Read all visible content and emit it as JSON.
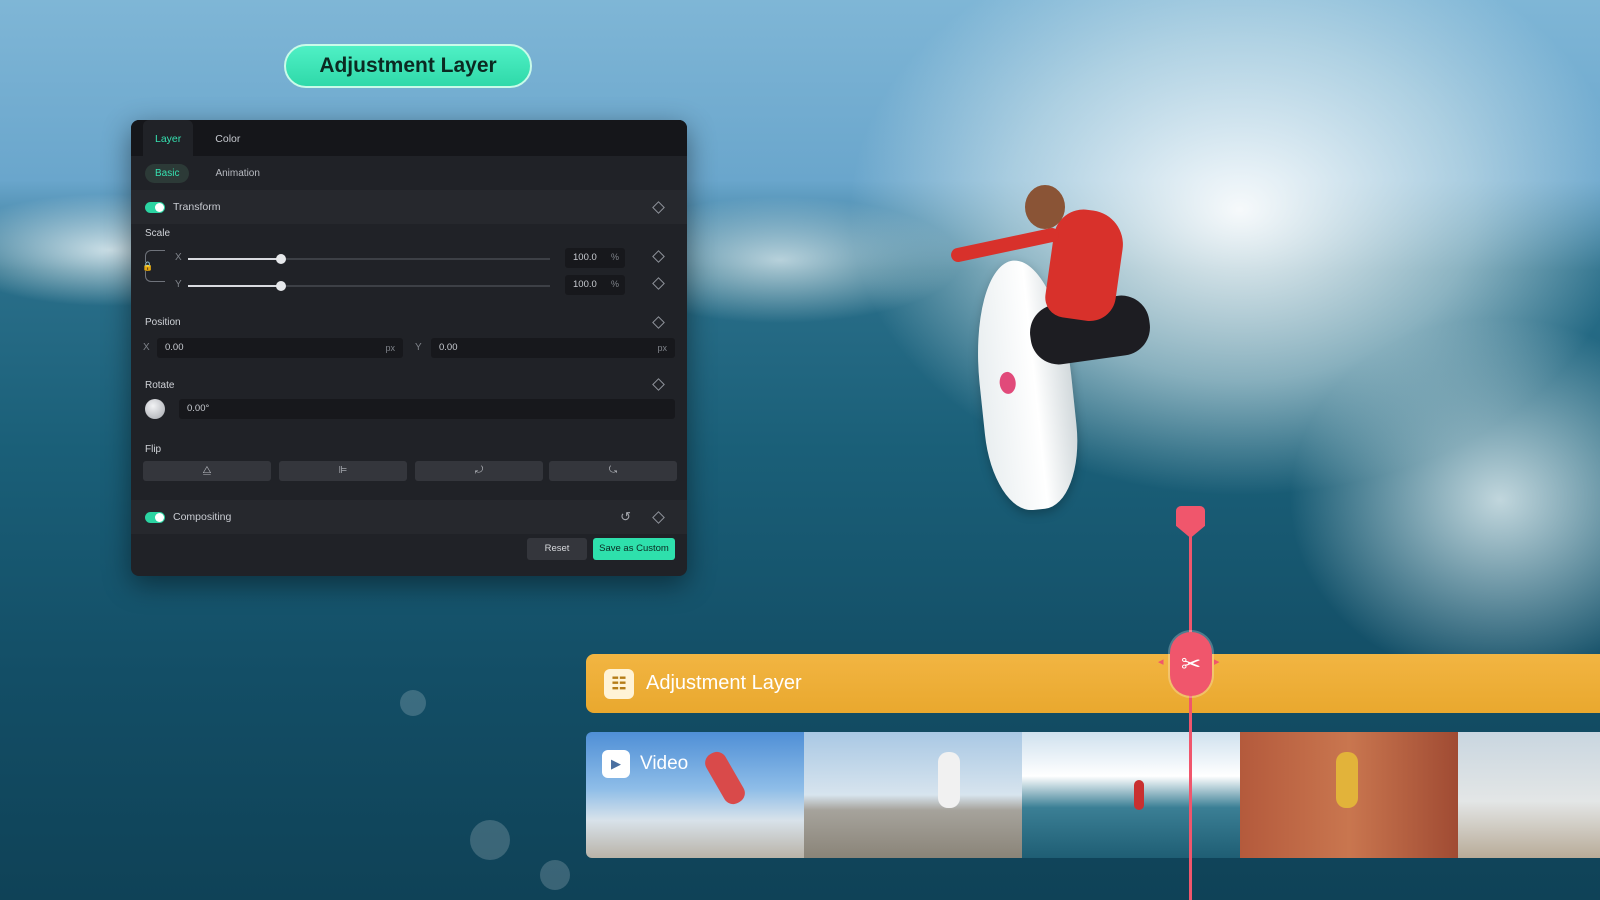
{
  "badge": {
    "title": "Adjustment Layer"
  },
  "panel": {
    "tabs": [
      "Layer",
      "Color"
    ],
    "subtabs": [
      "Basic",
      "Animation"
    ],
    "transform": {
      "label": "Transform",
      "scale_label": "Scale",
      "x_axis": "X",
      "y_axis": "Y",
      "scale_x": "100.0",
      "scale_y": "100.0",
      "percent": "%",
      "scale_slider_fraction": 0.25,
      "position_label": "Position",
      "pos_x_value": "0.00",
      "pos_y_value": "0.00",
      "px": "px",
      "rotate_label": "Rotate",
      "rotate_value": "0.00°",
      "flip_label": "Flip",
      "flip_icons": [
        "flip-horizontal-icon",
        "flip-vertical-icon",
        "rotate-right-icon",
        "rotate-left-icon"
      ],
      "flip_glyphs": [
        "⧋",
        "⊫",
        "⤾",
        "⤿"
      ]
    },
    "compositing": {
      "label": "Compositing"
    },
    "buttons": {
      "reset": "Reset",
      "save": "Save as Custom"
    }
  },
  "timeline": {
    "adjustment_track_label": "Adjustment Layer",
    "video_label": "Video",
    "adjustment_icon_glyph": "☷",
    "play_glyph": "▶",
    "scissors_glyph": "✂"
  },
  "colors": {
    "accent": "#2ee0ac",
    "track": "#f2b542",
    "playhead": "#f0566c"
  }
}
